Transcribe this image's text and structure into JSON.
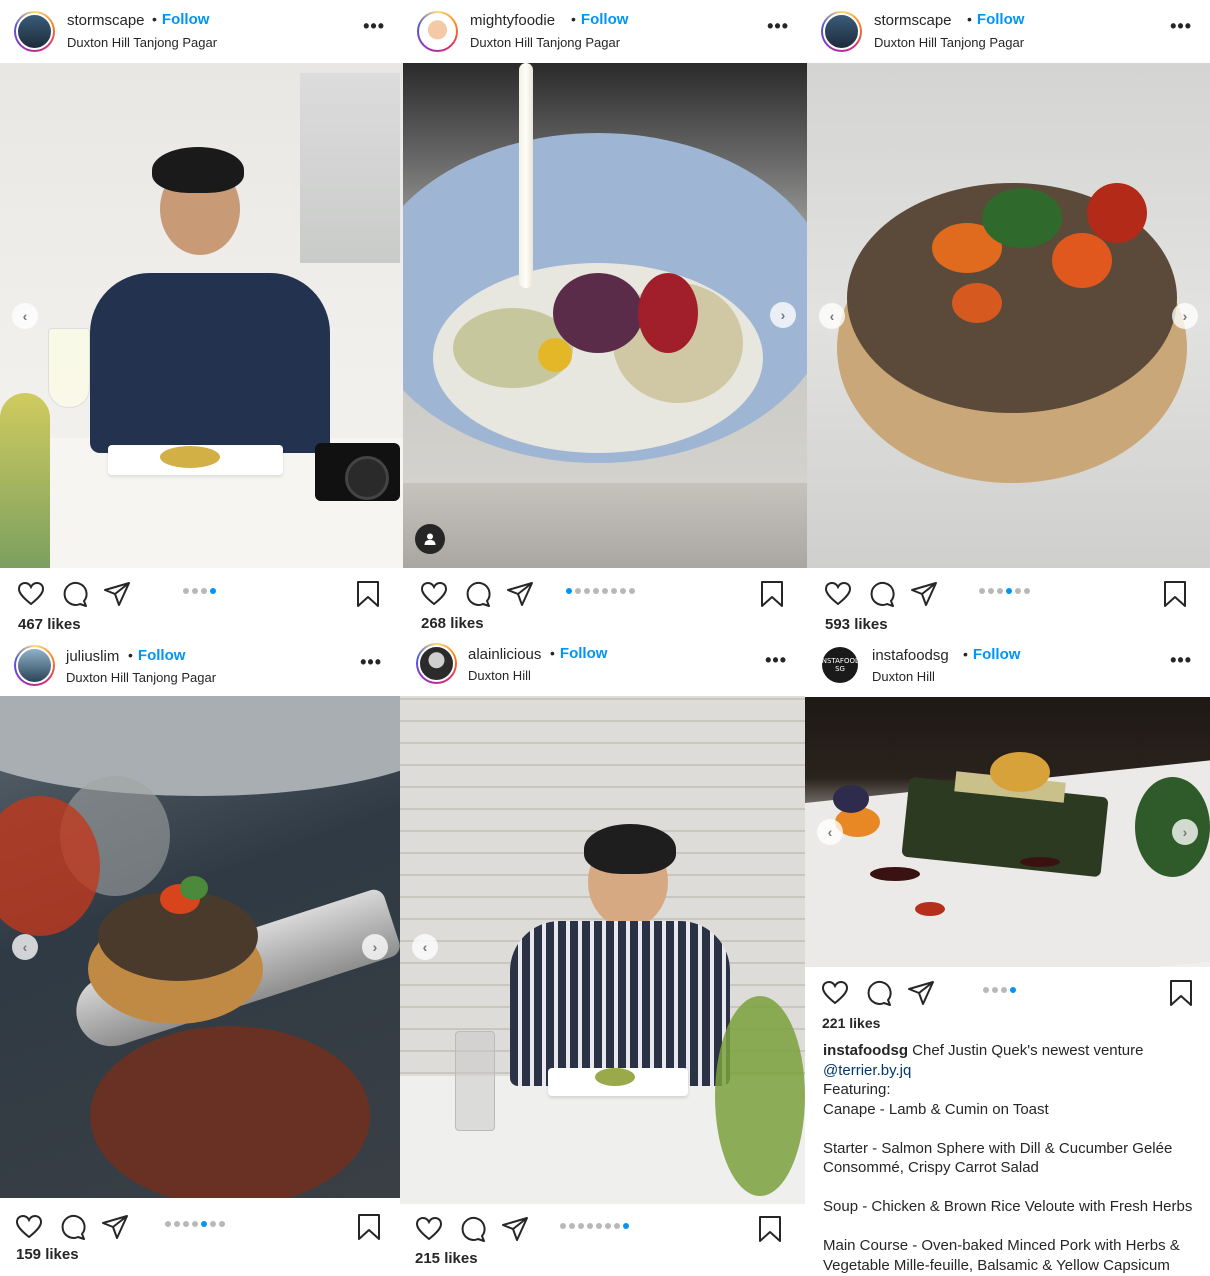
{
  "posts": [
    {
      "username": "stormscape",
      "follow": "Follow",
      "location": "Duxton Hill Tanjong Pagar",
      "more": "•••",
      "likes": "467 likes",
      "dots": 4,
      "active_dot": 3,
      "photo_alt": "smiling man dining with camera"
    },
    {
      "username": "mightyfoodie",
      "follow": "Follow",
      "location": "Duxton Hill Tanjong Pagar",
      "more": "•••",
      "likes": "268 likes",
      "dots": 8,
      "active_dot": 0,
      "photo_alt": "plated dish with sauce pour"
    },
    {
      "username": "stormscape",
      "follow": "Follow",
      "location": "Duxton Hill Tanjong Pagar",
      "more": "•••",
      "likes": "593 likes",
      "dots": 6,
      "active_dot": 3,
      "photo_alt": "lamb canape on toast"
    },
    {
      "username": "juliuslim",
      "follow": "Follow",
      "location": "Duxton Hill Tanjong Pagar",
      "more": "•••",
      "likes": "159 likes",
      "dots": 7,
      "active_dot": 4,
      "photo_alt": "canape on a spoon"
    },
    {
      "username": "alainlicious",
      "follow": "Follow",
      "location": "Duxton Hill",
      "more": "•••",
      "likes": "215 likes",
      "dots": 8,
      "active_dot": 7,
      "photo_alt": "man eating at table"
    },
    {
      "username": "instafoodsg",
      "follow": "Follow",
      "location": "Duxton Hill",
      "more": "•••",
      "likes": "221 likes",
      "dots": 4,
      "active_dot": 3,
      "avatar_text": "INSTAFOOD SG",
      "photo_alt": "vegetable mille-feuille"
    }
  ],
  "caption": {
    "username": "instafoodsg",
    "text": "Chef Justin Quek's newest venture",
    "mention": "@terrier.by.jq",
    "lines": [
      "Featuring:",
      "Canape - Lamb & Cumin on Toast",
      "",
      "Starter - Salmon Sphere with Dill & Cucumber Gelée Consommé, Crispy Carrot Salad",
      "",
      "Soup - Chicken & Brown Rice Veloute with Fresh Herbs",
      "",
      "Main Course - Oven-baked Minced Pork with Herbs & Vegetable Mille-feuille, Balsamic & Yellow Capsicum"
    ]
  },
  "icons": {
    "like": "heart-icon",
    "comment": "comment-icon",
    "share": "paper-plane-icon",
    "save": "bookmark-icon",
    "prev": "chevron-left-icon",
    "next": "chevron-right-icon"
  },
  "colors": {
    "accent": "#0095f6",
    "dot_inactive": "#b8b8b8",
    "text": "#262626"
  }
}
